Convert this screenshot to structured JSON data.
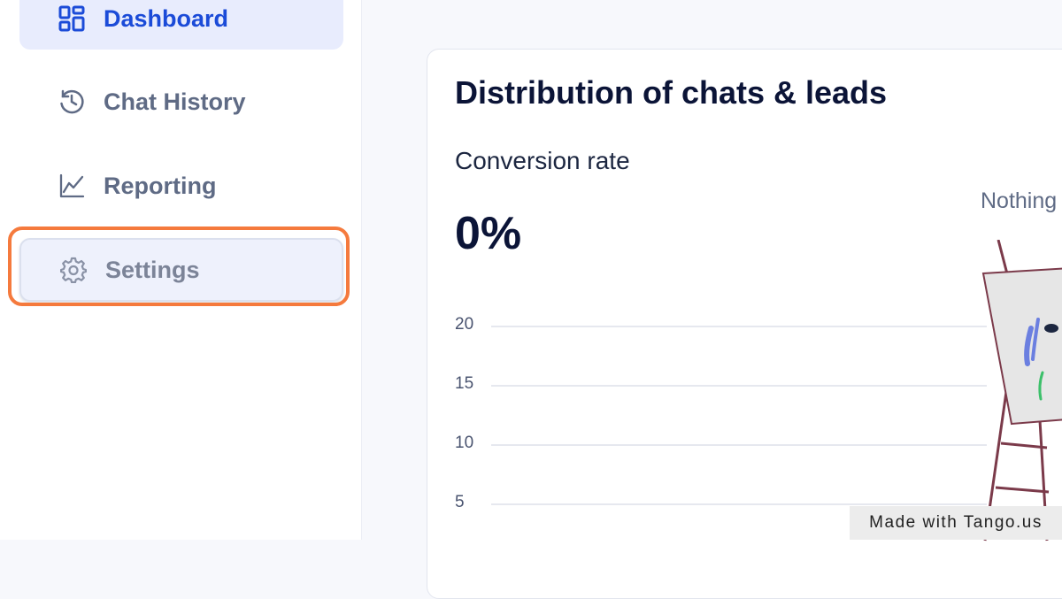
{
  "sidebar": {
    "items": [
      {
        "label": "Dashboard",
        "icon": "dashboard-grid-icon",
        "active": true
      },
      {
        "label": "Chat History",
        "icon": "history-clock-icon"
      },
      {
        "label": "Reporting",
        "icon": "line-chart-icon"
      },
      {
        "label": "Settings",
        "icon": "gear-icon",
        "highlighted": true
      }
    ]
  },
  "main": {
    "card": {
      "title": "Distribution of chats & leads",
      "conversion_label": "Conversion rate",
      "conversion_value": "0%",
      "empty_state_text": "Nothing"
    }
  },
  "chart_data": {
    "type": "bar",
    "y_ticks": [
      "20",
      "15",
      "10",
      "5"
    ],
    "ylim": [
      0,
      20
    ],
    "grid": true,
    "categories": [],
    "values": []
  },
  "watermark": {
    "text": "Made with Tango.us"
  },
  "colors": {
    "accent": "#1b4bd8",
    "highlight": "#f57a3d",
    "active_bg": "#e8ecfd",
    "text_dark": "#0b1437"
  }
}
